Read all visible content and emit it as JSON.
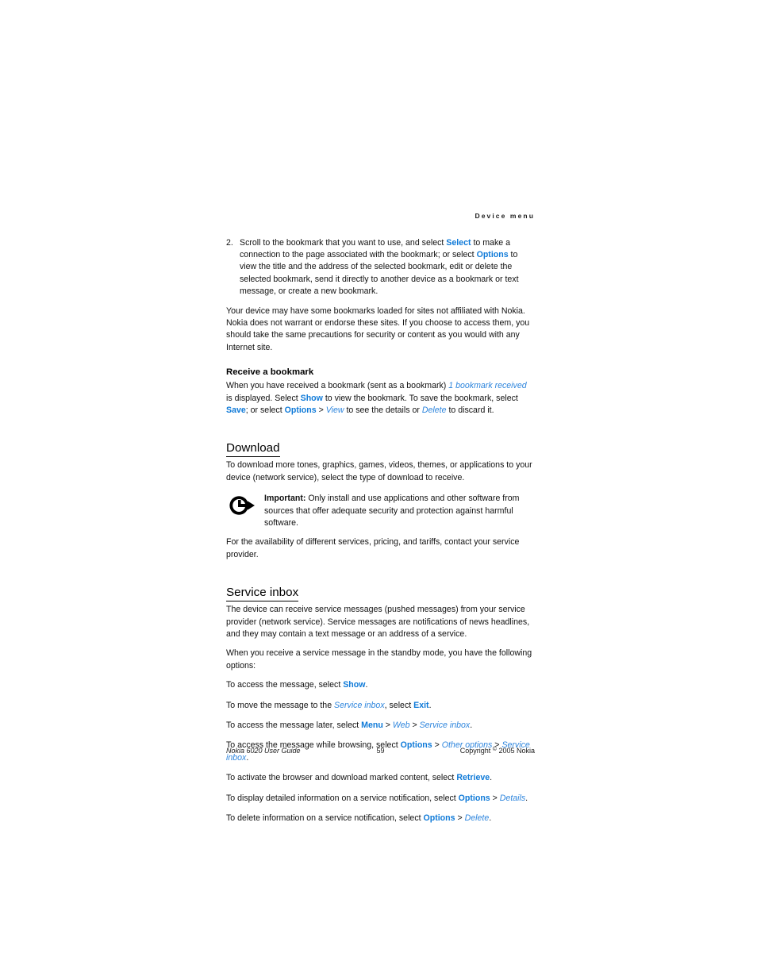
{
  "header": {
    "running_head": "Device menu"
  },
  "content": {
    "step2": {
      "number": "2.",
      "t1": "Scroll to the bookmark that you want to use, and select ",
      "ui1": "Select",
      "t2": " to make a connection to the page associated with the bookmark; or select ",
      "ui2": "Options",
      "t3": " to view the title and the address of the selected bookmark, edit or delete the selected bookmark, send it directly to another device as a bookmark or text message, or create a new bookmark."
    },
    "disclaimer": "Your device may have some bookmarks loaded for sites not affiliated with Nokia. Nokia does not warrant or endorse these sites. If you choose to access them, you should take the same precautions for security or content as you would with any Internet site.",
    "receive_bookmark": {
      "heading": "Receive a bookmark",
      "t1": "When you have received a bookmark (sent as a bookmark) ",
      "ui_italic1": "1 bookmark received",
      "t2": " is displayed. Select ",
      "ui1": "Show",
      "t3": " to view the bookmark. To save the bookmark, select ",
      "ui2": "Save",
      "t4": "; or select ",
      "ui3": "Options",
      "t5": " > ",
      "ui_italic2": "View",
      "t6": " to see the details or ",
      "ui_italic3": "Delete",
      "t7": " to discard it."
    },
    "download": {
      "heading": "Download",
      "intro": "To download more tones, graphics, games, videos, themes, or applications to your device (network service), select the type of download to receive.",
      "note_label": "Important:",
      "note_text": " Only install and use applications and other software from sources that offer adequate security and protection against harmful software.",
      "availability": "For the availability of different services, pricing, and tariffs, contact your service provider."
    },
    "service_inbox": {
      "heading": "Service inbox",
      "intro": "The device can receive service messages (pushed messages) from your service provider (network service). Service messages are notifications of news headlines, and they may contain a text message or an address of a service.",
      "standby": "When you receive a service message in the standby mode, you have the following options:",
      "lines": {
        "l1_a": "To access the message, select ",
        "l1_ui": "Show",
        "l1_b": ".",
        "l2_a": "To move the message to the ",
        "l2_it": "Service inbox",
        "l2_b": ", select ",
        "l2_ui": "Exit",
        "l2_c": ".",
        "l3_a": "To access the message later, select ",
        "l3_ui": "Menu",
        "l3_b": " > ",
        "l3_it1": "Web",
        "l3_c": " > ",
        "l3_it2": "Service inbox",
        "l3_d": ".",
        "l4_a": "To access the message while browsing, select ",
        "l4_ui": "Options",
        "l4_b": " > ",
        "l4_it1": "Other options",
        "l4_c": " > ",
        "l4_it2": "Service inbox",
        "l4_d": ".",
        "l5_a": "To activate the browser and download marked content, select ",
        "l5_ui": "Retrieve",
        "l5_b": ".",
        "l6_a": "To display detailed information on a service notification, select ",
        "l6_ui": "Options",
        "l6_b": " > ",
        "l6_it": "Details",
        "l6_c": ".",
        "l7_a": "To delete information on a service notification, select ",
        "l7_ui": "Options",
        "l7_b": " > ",
        "l7_it": "Delete",
        "l7_c": "."
      }
    }
  },
  "footer": {
    "guide": "Nokia 6020 User Guide",
    "page_number": "59",
    "copyright_pre": "Copyright ",
    "copyright_sym": "©",
    "copyright_post": " 2005 Nokia"
  },
  "colors": {
    "ui_blue": "#0f7ad8",
    "ui_blue_italic": "#2f86dd",
    "text": "#111111"
  }
}
